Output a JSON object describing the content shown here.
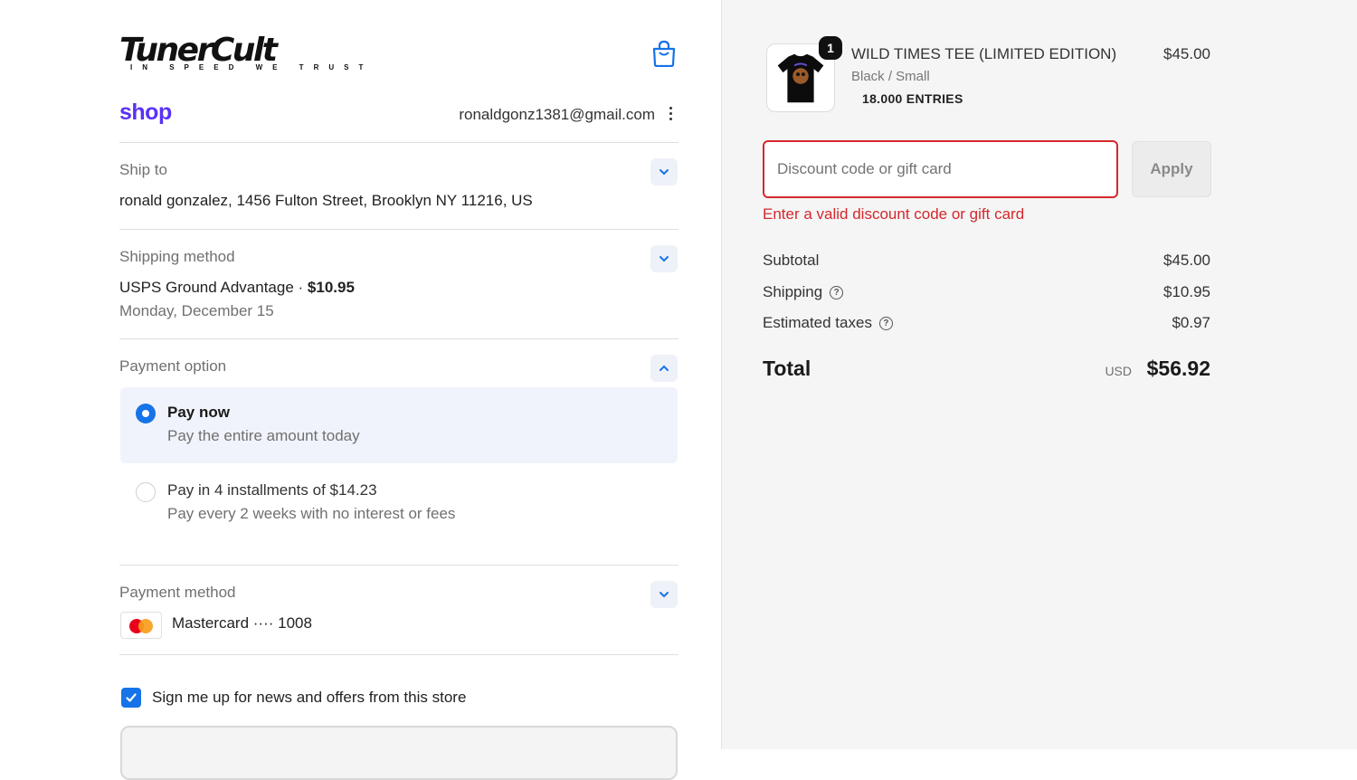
{
  "brand": {
    "name": "TunerCult",
    "tagline": "IN SPEED WE TRUST",
    "shop_pay": "shop"
  },
  "account": {
    "email": "ronaldgonz1381@gmail.com"
  },
  "ship_to": {
    "label": "Ship to",
    "address": "ronald gonzalez, 1456 Fulton Street, Brooklyn NY 11216, US"
  },
  "shipping_method": {
    "label": "Shipping method",
    "name": "USPS Ground Advantage ·",
    "price": "$10.95",
    "date": "Monday, December 15"
  },
  "payment_option": {
    "label": "Payment option",
    "options": [
      {
        "title": "Pay now",
        "subtitle": "Pay the entire amount today",
        "selected": true
      },
      {
        "title": "Pay in 4 installments of $14.23",
        "subtitle": "Pay every 2 weeks with no interest or fees",
        "selected": false
      }
    ]
  },
  "payment_method": {
    "label": "Payment method",
    "card": "Mastercard ···· 1008"
  },
  "newsletter": {
    "label": "Sign me up for news and offers from this store",
    "checked": true
  },
  "cart": {
    "quantity": "1",
    "product_name": "WILD TIMES TEE (LIMITED EDITION)",
    "product_price": "$45.00",
    "variant": "Black / Small",
    "note": "18.000 ENTRIES"
  },
  "discount": {
    "placeholder": "Discount code or gift card",
    "apply_label": "Apply",
    "error": "Enter a valid discount code or gift card"
  },
  "summary": {
    "subtotal_label": "Subtotal",
    "subtotal": "$45.00",
    "shipping_label": "Shipping",
    "shipping": "$10.95",
    "taxes_label": "Estimated taxes",
    "taxes": "$0.97",
    "total_label": "Total",
    "currency": "USD",
    "total": "$56.92"
  },
  "colors": {
    "accent": "#1773e8",
    "shop_purple": "#5a31f4",
    "error": "#d4282c"
  }
}
